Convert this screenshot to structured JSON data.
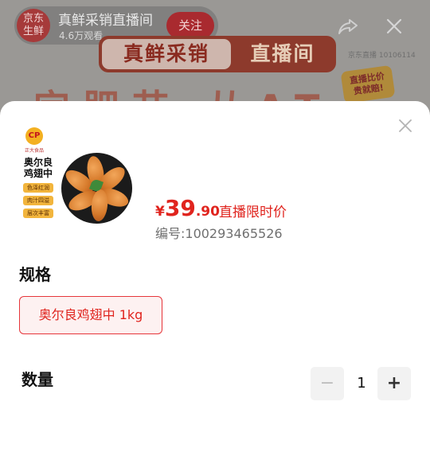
{
  "live": {
    "avatar_line1": "京东",
    "avatar_line2": "生鲜",
    "title": "真鲜采销直播间",
    "viewers": "4.6万观看",
    "follow_label": "关注",
    "banner_left": "真鲜采销",
    "banner_right": "直播间",
    "shop_id": "京东直播 10106114",
    "bg_text": "完肥节 从AT",
    "badge_line1": "直播比价",
    "badge_line2": "贵就赔!"
  },
  "product": {
    "image": {
      "logo": "CP",
      "brand": "正大食品",
      "name": "奥尔良鸡翅中",
      "tags": [
        "色泽红润",
        "肉汁四溢",
        "层次丰富"
      ]
    },
    "price": {
      "currency": "¥",
      "integer": "39",
      "decimal": ".90",
      "label": "直播限时价"
    },
    "sku": "编号:100293465526"
  },
  "spec": {
    "title": "规格",
    "selected_option": "奥尔良鸡翅中 1kg"
  },
  "quantity": {
    "title": "数量",
    "minus": "−",
    "value": "1",
    "plus": "+"
  },
  "icons": {
    "share": "share-icon",
    "close_top": "close-icon",
    "sheet_close": "close-icon"
  },
  "colors": {
    "accent": "#e0241e",
    "chip_bg": "#fdf1f1",
    "stepper_bg": "#f2f2f2"
  }
}
